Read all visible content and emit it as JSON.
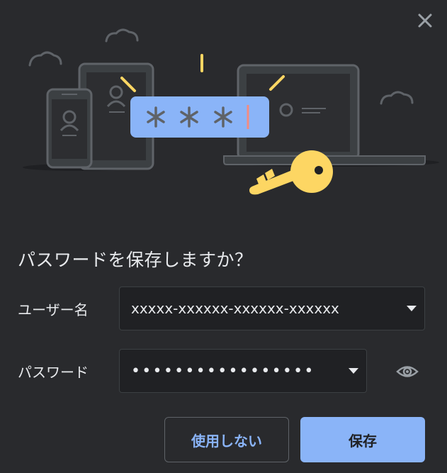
{
  "dialog": {
    "title": "パスワードを保存しますか？",
    "username_label": "ユーザー名",
    "username_value": "xxxxx-xxxxxx-xxxxxx-xxxxxx",
    "password_label": "パスワード",
    "password_value": "•••••••••••••••••",
    "cancel_label": "使用しない",
    "save_label": "保存"
  },
  "colors": {
    "background": "#292a2d",
    "accent": "#8ab4f8",
    "field_background": "#202124",
    "text": "#e8eaed",
    "key": "#fdd663"
  },
  "icons": {
    "close": "close-icon",
    "username_dropdown": "chevron-down-icon",
    "password_dropdown": "chevron-down-icon",
    "reveal": "eye-icon"
  }
}
